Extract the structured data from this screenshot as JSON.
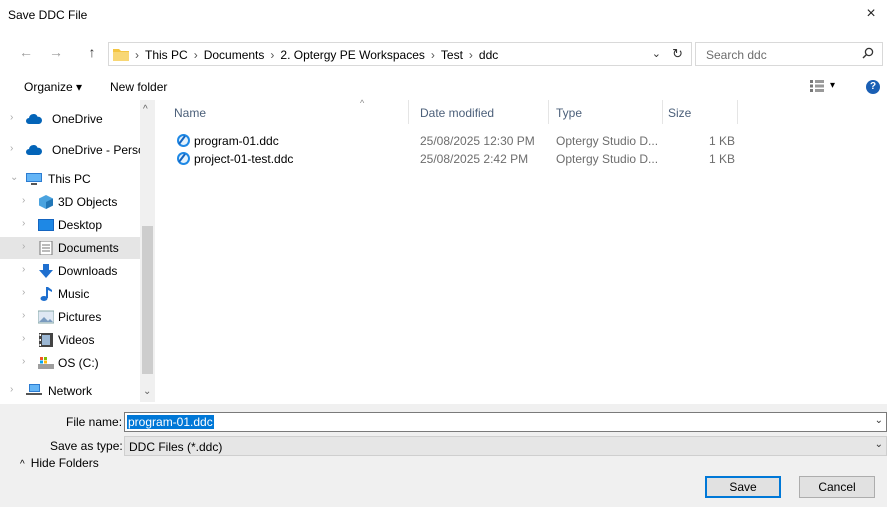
{
  "window": {
    "title": "Save DDC File",
    "close_glyph": "×"
  },
  "nav_buttons": {
    "back": "←",
    "forward": "→",
    "up": "↑"
  },
  "address": {
    "lead_sep": "›",
    "crumbs": [
      "This PC",
      "Documents",
      "2. Optergy PE Workspaces",
      "Test",
      "ddc"
    ],
    "sep": "›",
    "dropdown": "⌄",
    "refresh": "↻"
  },
  "search": {
    "placeholder": "Search ddc"
  },
  "toolbar": {
    "organize": "Organize ▾",
    "new_folder": "New folder",
    "view_dropdown": "▾",
    "help": "?"
  },
  "nav_scroll": {
    "up": "^",
    "down": "⌄"
  },
  "nav": [
    {
      "label": "OneDrive",
      "icon": "cloud-icon",
      "chev": "›"
    },
    {
      "label": "OneDrive - Persor",
      "icon": "cloud-icon",
      "chev": "›"
    },
    {
      "label": "This PC",
      "icon": "computer-icon",
      "chev": "⌄"
    },
    {
      "label": "3D Objects",
      "icon": "cube-icon",
      "chev": "›"
    },
    {
      "label": "Desktop",
      "icon": "desktop-icon",
      "chev": "›"
    },
    {
      "label": "Documents",
      "icon": "document-icon",
      "chev": "›",
      "selected": true
    },
    {
      "label": "Downloads",
      "icon": "download-icon",
      "chev": "›"
    },
    {
      "label": "Music",
      "icon": "music-icon",
      "chev": "›"
    },
    {
      "label": "Pictures",
      "icon": "pictures-icon",
      "chev": "›"
    },
    {
      "label": "Videos",
      "icon": "video-icon",
      "chev": "›"
    },
    {
      "label": "OS (C:)",
      "icon": "drive-icon",
      "chev": "›"
    },
    {
      "label": "Network",
      "icon": "network-icon",
      "chev": "›"
    }
  ],
  "columns": {
    "name": "Name",
    "date": "Date modified",
    "type": "Type",
    "size": "Size",
    "sort_glyph": "^"
  },
  "files": [
    {
      "name": "program-01.ddc",
      "date": "25/08/2025 12:30 PM",
      "type": "Optergy Studio D...",
      "size": "1 KB"
    },
    {
      "name": "project-01-test.ddc",
      "date": "25/08/2025 2:42 PM",
      "type": "Optergy Studio D...",
      "size": "1 KB"
    }
  ],
  "form": {
    "file_name_label": "File name:",
    "file_name_value": "program-01.ddc",
    "save_type_label": "Save as type:",
    "save_type_value": "DDC Files (*.ddc)",
    "dropdown_glyph": "⌄"
  },
  "footer": {
    "hide_folders": "Hide Folders",
    "hide_caret": "^",
    "save": "Save",
    "cancel": "Cancel"
  },
  "colors": {
    "accent": "#0078d7",
    "selected_bg": "#e5e5e5",
    "folder": "#f4c542"
  }
}
